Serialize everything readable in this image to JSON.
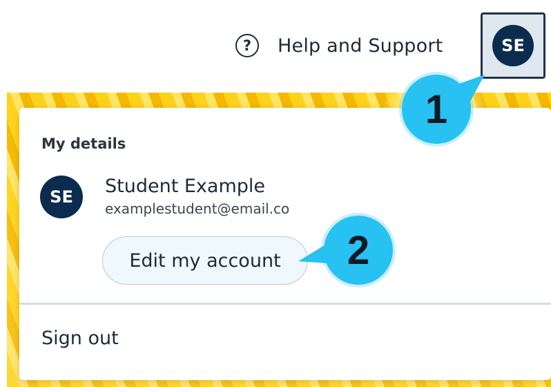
{
  "header": {
    "help_label": "Help and Support",
    "help_icon": "question-circle-icon",
    "help_icon_glyph": "?",
    "avatar_initials": "SE"
  },
  "account_menu": {
    "section_heading": "My details",
    "user": {
      "initials": "SE",
      "name": "Student Example",
      "email": "examplestudent@email.co"
    },
    "edit_button_label": "Edit my account",
    "sign_out_label": "Sign out"
  },
  "callouts": [
    {
      "number": "1"
    },
    {
      "number": "2"
    }
  ],
  "colors": {
    "avatar_bg": "#0b2c4f",
    "callout": "#27c1f2",
    "edit_button_bg": "#eef8fd",
    "text_primary": "#1e2a38"
  }
}
